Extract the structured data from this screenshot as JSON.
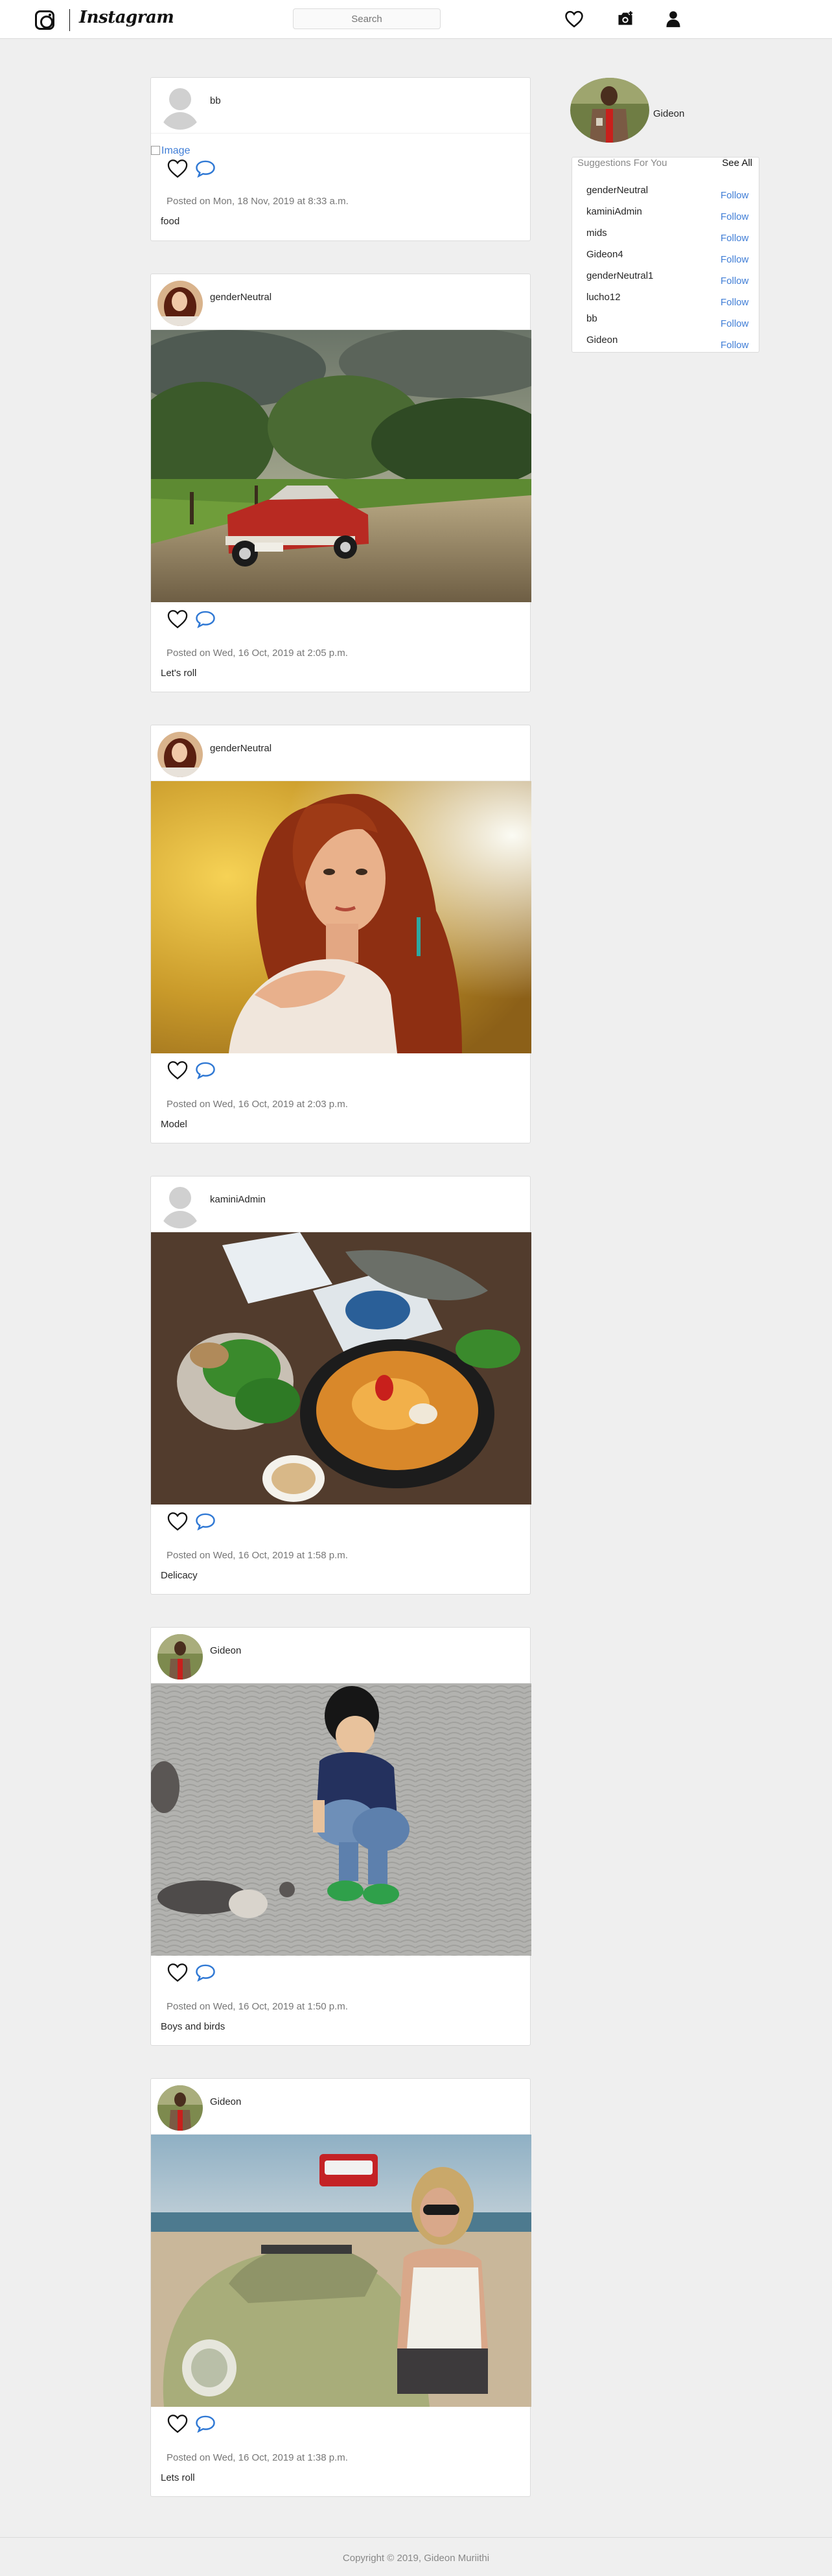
{
  "app": {
    "wordmark": "Instagram"
  },
  "nav": {
    "search_placeholder": "Search"
  },
  "icons": {
    "logo": "camera-outline-icon",
    "likes": "heart-outline-icon",
    "upload": "camera-icon",
    "profile": "user-icon",
    "like": "heart-outline-icon",
    "comment": "speech-bubble-icon"
  },
  "colors": {
    "background": "#efefef",
    "card": "#ffffff",
    "border": "#dbdbdb",
    "link_blue": "#3f7dd6",
    "meta_gray": "#777777"
  },
  "posts": [
    {
      "username": "bb",
      "broken_image_alt": "Image",
      "posted": "Posted on Mon, 18 Nov, 2019 at 8:33 a.m.",
      "caption": "food"
    },
    {
      "username": "genderNeutral",
      "posted": "Posted on Wed, 16 Oct, 2019 at 2:05 p.m.",
      "caption": "Let's roll"
    },
    {
      "username": "genderNeutral",
      "posted": "Posted on Wed, 16 Oct, 2019 at 2:03 p.m.",
      "caption": "Model"
    },
    {
      "username": "kaminiAdmin",
      "posted": "Posted on Wed, 16 Oct, 2019 at 1:58 p.m.",
      "caption": "Delicacy"
    },
    {
      "username": "Gideon",
      "posted": "Posted on Wed, 16 Oct, 2019 at 1:50 p.m.",
      "caption": "Boys and birds"
    },
    {
      "username": "Gideon",
      "posted": "Posted on Wed, 16 Oct, 2019 at 1:38 p.m.",
      "caption": "Lets roll"
    }
  ],
  "sidebar": {
    "user_name": "Gideon",
    "suggestions_title": "Suggestions For You",
    "see_all": "See All",
    "follow_label": "Follow",
    "suggestions": [
      {
        "name": "genderNeutral"
      },
      {
        "name": "kaminiAdmin"
      },
      {
        "name": "mids"
      },
      {
        "name": "Gideon4"
      },
      {
        "name": "genderNeutral1"
      },
      {
        "name": "lucho12"
      },
      {
        "name": "bb"
      },
      {
        "name": "Gideon"
      }
    ]
  },
  "footer": {
    "copyright": "Copyright © 2019, Gideon Muriithi"
  }
}
